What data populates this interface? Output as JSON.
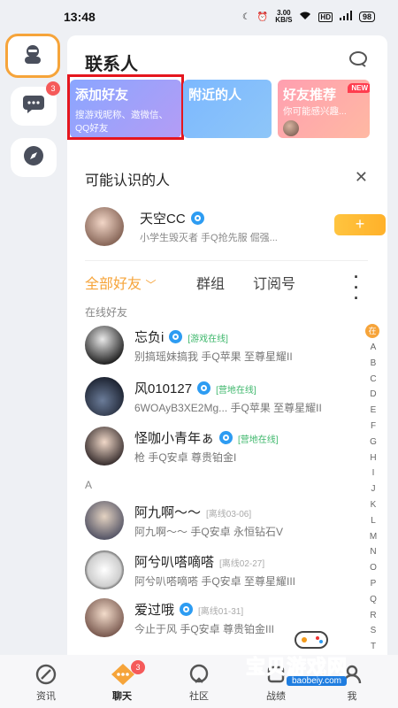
{
  "status_bar": {
    "time": "13:48",
    "speed": "3.00",
    "speed_unit": "KB/S",
    "battery": "98"
  },
  "rail": {
    "messages_badge": "3"
  },
  "contacts": {
    "title": "联系人",
    "promos": [
      {
        "title": "添加好友",
        "subtitle": "搜游戏昵称、邀微信、QQ好友"
      },
      {
        "title": "附近的人",
        "subtitle": ""
      },
      {
        "title": "好友推荐",
        "subtitle": "你可能感兴趣...",
        "tag": "NEW"
      }
    ],
    "suggest_header": "可能认识的人",
    "suggest": {
      "name": "天空CC",
      "desc": "小学生毁灭者 手Q抢先服 倔强...",
      "add_label": "+"
    },
    "tabs": [
      "全部好友",
      "群组",
      "订阅号"
    ],
    "group_online": "在线好友",
    "online_friends": [
      {
        "name": "忘负i",
        "status": "[游戏在线]",
        "desc": "别搞瑶妹搞我  手Q苹果  至尊星耀II"
      },
      {
        "name": "风010127",
        "status": "[营地在线]",
        "desc": "6WOAyB3XE2Mg...  手Q苹果  至尊星耀II"
      },
      {
        "name": "怪咖小青年ぁ",
        "status": "[营地在线]",
        "desc": "枪   手Q安卓  尊贵铂金I"
      }
    ],
    "group_a": "A",
    "a_friends": [
      {
        "name": "阿九啊～～",
        "status": "[离线03-06]",
        "desc": "阿九啊～～  手Q安卓  永恒钻石V"
      },
      {
        "name": "阿兮叭嗒嘀嗒",
        "status": "[离线02-27]",
        "desc": "阿兮叭嗒嘀嗒  手Q安卓  至尊星耀III"
      },
      {
        "name": "爱过哦",
        "status": "[离线01-31]",
        "desc": "今止于风  手Q安卓  尊贵铂金III"
      }
    ],
    "index": {
      "star": "在",
      "letters": [
        "A",
        "B",
        "C",
        "D",
        "E",
        "F",
        "G",
        "H",
        "I",
        "J",
        "K",
        "L",
        "M",
        "N",
        "O",
        "P",
        "Q",
        "R",
        "S",
        "T"
      ]
    }
  },
  "bottom_nav": [
    {
      "label": "资讯",
      "icon": "news-icon"
    },
    {
      "label": "聊天",
      "icon": "chat-icon",
      "badge": "3"
    },
    {
      "label": "社区",
      "icon": "community-icon"
    },
    {
      "label": "战绩",
      "icon": "record-icon"
    },
    {
      "label": "我",
      "icon": "me-icon"
    }
  ],
  "watermark": {
    "text": "宝贝游戏网",
    "url": "baobeiy.com"
  },
  "colors": {
    "accent": "#f6a43a",
    "highlight_box": "#e5161e",
    "online": "#3db76b"
  }
}
